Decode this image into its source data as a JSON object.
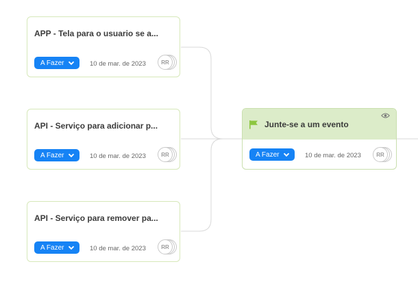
{
  "status_label": "A Fazer",
  "avatar_initials": "RR",
  "main_task": {
    "title": "Junte-se a um evento",
    "date": "10 de mar. de 2023"
  },
  "subtasks": [
    {
      "title": "APP - Tela para o usuario se a...",
      "date": "10 de mar. de 2023"
    },
    {
      "title": "API - Serviço para adicionar p...",
      "date": "10 de mar. de 2023"
    },
    {
      "title": "API - Serviço para remover pa...",
      "date": "10 de mar. de 2023"
    }
  ],
  "colors": {
    "accent": "#1683f5",
    "card_border": "#d6e8b9",
    "header_green": "#dcecc9",
    "flag_green": "#8cc63f",
    "connector": "#d8d8d8"
  }
}
